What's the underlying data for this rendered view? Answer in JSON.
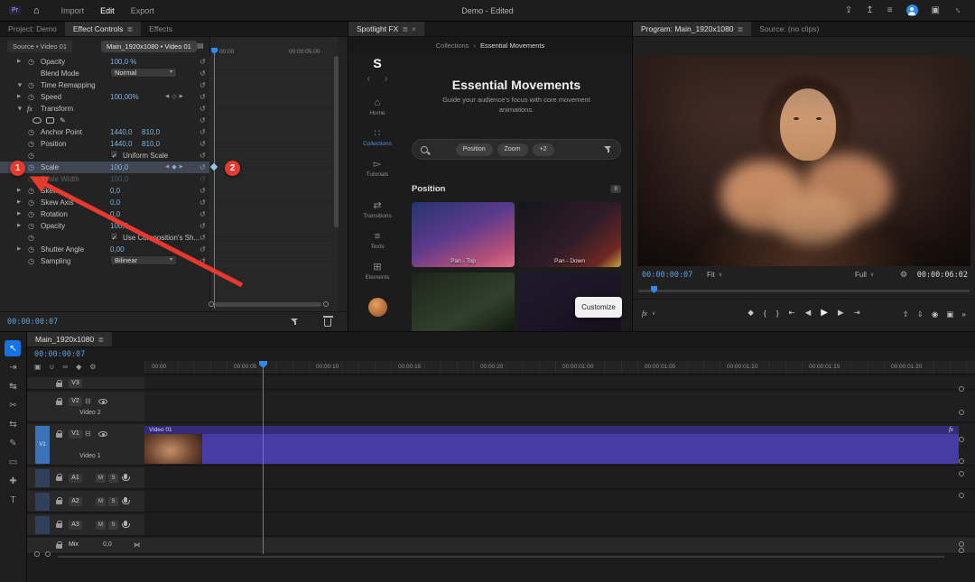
{
  "icons": {
    "panel_menu": "≣",
    "close": "×",
    "home": "⌂",
    "caret_down": "∨",
    "chevron": "▶",
    "check": "✓",
    "stopwatch": "◷",
    "reset": "↺",
    "fx_badge": "fx",
    "wrench": "⚙",
    "sync": "⊟",
    "keyframe_view": "▤",
    "mix_automation": "⋈"
  },
  "menubar": {
    "app_badge": "Pr",
    "items": [
      {
        "label": "Import",
        "active": false
      },
      {
        "label": "Edit",
        "active": true
      },
      {
        "label": "Export",
        "active": false
      }
    ],
    "title": "Demo - Edited",
    "right_icons": [
      {
        "name": "quick-export-icon",
        "glyph": "⇪"
      },
      {
        "name": "share-icon",
        "glyph": "↥"
      },
      {
        "name": "workspaces-icon",
        "glyph": "≡"
      },
      {
        "name": "account-icon",
        "glyph": ""
      },
      {
        "name": "displays-icon",
        "glyph": "▣"
      },
      {
        "name": "fullscreen-icon",
        "glyph": "⇔"
      }
    ]
  },
  "effect_controls": {
    "tabs": [
      {
        "label": "Project: Demo",
        "active": false
      },
      {
        "label": "Effect Controls",
        "active": true
      },
      {
        "label": "Effects",
        "active": false
      }
    ],
    "source_chip": "Source • Video 01",
    "clip_chip": "Main_1920x1080 • Video 01",
    "ruler_start": "00:00",
    "ruler_end": "00:00:05:00",
    "timecode": "00:00:00:07",
    "rows": [
      {
        "chev": "right",
        "stopwatch": true,
        "label": "Opacity",
        "values": [
          "100,0 %"
        ]
      },
      {
        "label": "Blend Mode",
        "dropdown": "Normal"
      },
      {
        "chev": "down",
        "clock": true,
        "label": "Time Remapping"
      },
      {
        "chev": "right",
        "stopwatch": true,
        "label": "Speed",
        "values": [
          "100,00%"
        ],
        "nav": "empty"
      },
      {
        "chev": "down",
        "fx": true,
        "label": "Transform"
      },
      {
        "shapes": true
      },
      {
        "stopwatch": true,
        "label": "Anchor Point",
        "values": [
          "1440,0",
          "810,0"
        ]
      },
      {
        "stopwatch": true,
        "label": "Position",
        "values": [
          "1440,0",
          "810,0"
        ]
      },
      {
        "stopwatch": true,
        "checkbox": true,
        "check_label": "Uniform Scale",
        "checked": true
      },
      {
        "chev": "right",
        "stopwatch": true,
        "sw_active": true,
        "label": "Scale",
        "values": [
          "100,0"
        ],
        "nav": "filled",
        "selected": true
      },
      {
        "stopwatch": true,
        "label": "Scale Width",
        "values": [
          "100,0"
        ],
        "disabled": true
      },
      {
        "chev": "right",
        "stopwatch": true,
        "label": "Skew",
        "values": [
          "0,0"
        ]
      },
      {
        "chev": "right",
        "stopwatch": true,
        "label": "Skew Axis",
        "values": [
          "0,0"
        ]
      },
      {
        "chev": "right",
        "stopwatch": true,
        "label": "Rotation",
        "values": [
          "0,0"
        ]
      },
      {
        "chev": "right",
        "stopwatch": true,
        "label": "Opacity",
        "values": [
          "100,0"
        ]
      },
      {
        "stopwatch": true,
        "checkbox": true,
        "check_label": "Use Composition's Sh...",
        "checked": true
      },
      {
        "chev": "right",
        "stopwatch": true,
        "label": "Shutter Angle",
        "values": [
          "0,00"
        ]
      },
      {
        "stopwatch": true,
        "label": "Sampling",
        "dropdown": "Bilinear"
      }
    ]
  },
  "spotlight": {
    "tab": "Spotlight FX",
    "breadcrumb_parent": "Collections",
    "breadcrumb_current": "Essential Movements",
    "logo": "S",
    "back": "‹",
    "forward": "›",
    "sidebar": [
      {
        "label": "Home",
        "icon": "home-icon",
        "glyph": "⌂",
        "active": false
      },
      {
        "label": "Collections",
        "icon": "collections-icon",
        "glyph": "∷",
        "active": true
      },
      {
        "label": "Tutorials",
        "icon": "tutorials-icon",
        "glyph": "▻",
        "active": false
      },
      {
        "label": "Transitions",
        "icon": "transitions-icon",
        "glyph": "⇄",
        "active": false
      },
      {
        "label": "Texts",
        "icon": "texts-icon",
        "glyph": "≡",
        "active": false
      },
      {
        "label": "Elements",
        "icon": "elements-icon",
        "glyph": "⊞",
        "active": false
      }
    ],
    "title": "Essential Movements",
    "subtitle": "Guide your audience's focus with core movement animations.",
    "filters": [
      "Position",
      "Zoom",
      "+2"
    ],
    "section_label": "Position",
    "section_count": "8",
    "items": [
      {
        "label": "Pan - Top",
        "art": "city"
      },
      {
        "label": "Pan - Down",
        "art": "street"
      },
      {
        "label": "",
        "art": "alley"
      },
      {
        "label": "",
        "art": "dark"
      }
    ],
    "customize_label": "Customize"
  },
  "program": {
    "tab": "Program: Main_1920x1080",
    "source_tab": "Source: (no clips)",
    "timecode": "00:00:00:07",
    "fit_label": "Fit",
    "resolution_label": "Full",
    "duration": "00:00:06:02",
    "transport_center": [
      {
        "name": "add-marker-button",
        "glyph": "◆"
      },
      {
        "name": "mark-in-button",
        "glyph": "{"
      },
      {
        "name": "mark-out-button",
        "glyph": "}"
      },
      {
        "name": "go-to-in-button",
        "glyph": "⇤"
      },
      {
        "name": "step-back-button",
        "glyph": "◀"
      },
      {
        "name": "play-button",
        "glyph": "▶"
      },
      {
        "name": "step-forward-button",
        "glyph": "▶"
      },
      {
        "name": "go-to-out-button",
        "glyph": "⇥"
      }
    ],
    "transport_right": [
      {
        "name": "lift-button",
        "glyph": "⇧"
      },
      {
        "name": "extract-button",
        "glyph": "⇩"
      },
      {
        "name": "export-frame-button",
        "glyph": "◉"
      },
      {
        "name": "comparison-view-button",
        "glyph": "▣"
      },
      {
        "name": "more-buttons",
        "glyph": "»"
      }
    ]
  },
  "timeline": {
    "tab": "Main_1920x1080",
    "timecode": "00:00:00:07",
    "ruler": [
      "00:00",
      "00:00:05",
      "00:00:10",
      "00:00:15",
      "00:00:20",
      "00:00:01:00",
      "00:00:01:05",
      "00:00:01:10",
      "00:00:01:15",
      "00:00:01:20"
    ],
    "toolbar_icons": [
      {
        "name": "nested-sequence-icon",
        "glyph": "▣"
      },
      {
        "name": "snap-icon",
        "glyph": "∪"
      },
      {
        "name": "linked-selection-icon",
        "glyph": "∞"
      },
      {
        "name": "add-marker-icon",
        "glyph": "◆"
      },
      {
        "name": "timeline-settings-icon",
        "glyph": "⚙"
      }
    ],
    "video_tracks": [
      {
        "name": "V3",
        "label": ""
      },
      {
        "name": "V2",
        "label": "Video 2"
      },
      {
        "name": "V1",
        "label": "Video 1",
        "patch": "V1"
      }
    ],
    "clip_name": "Video 01",
    "clip_fx": "fx",
    "audio_tracks": [
      {
        "name": "A1",
        "mute": "M",
        "solo": "S"
      },
      {
        "name": "A2",
        "mute": "M",
        "solo": "S"
      },
      {
        "name": "A3",
        "mute": "M",
        "solo": "S"
      }
    ],
    "mix_label": "Mix",
    "mix_value": "0,0"
  },
  "tools": [
    {
      "name": "selection-tool",
      "glyph": "↖",
      "active": true
    },
    {
      "name": "track-select-tool",
      "glyph": "⇥",
      "active": false
    },
    {
      "name": "ripple-edit-tool",
      "glyph": "↹",
      "active": false
    },
    {
      "name": "razor-tool",
      "glyph": "✂",
      "active": false
    },
    {
      "name": "slip-tool",
      "glyph": "⇆",
      "active": false
    },
    {
      "name": "pen-tool",
      "glyph": "✎",
      "active": false
    },
    {
      "name": "rectangle-tool",
      "glyph": "▭",
      "active": false
    },
    {
      "name": "hand-tool",
      "glyph": "✚",
      "active": false
    },
    {
      "name": "type-tool",
      "glyph": "T",
      "active": false
    }
  ],
  "annotations": {
    "step1": "1",
    "step2": "2",
    "red": "#e8392e"
  },
  "colors": {
    "accent_blue": "#2d8ceb",
    "value_blue": "#7db3e0",
    "clip_purple": "#473ca6"
  }
}
